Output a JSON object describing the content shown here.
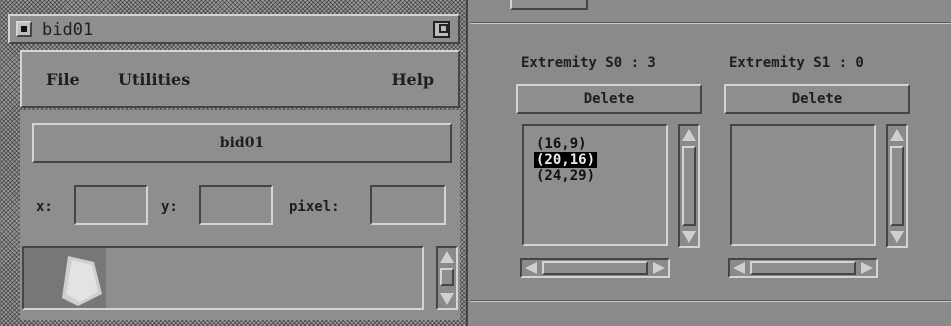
{
  "window": {
    "title": "bid01",
    "menu": {
      "file": "File",
      "utilities": "Utilities",
      "help": "Help"
    },
    "image_name_button": "bid01",
    "coords": {
      "x_label": "x:",
      "y_label": "y:",
      "pixel_label": "pixel:",
      "x_value": "",
      "y_value": "",
      "pixel_value": ""
    }
  },
  "extremities": {
    "s0": {
      "header": "Extremity S0 : 3",
      "delete_label": "Delete",
      "points": [
        "(16,9)",
        "(20,16)",
        "(24,29)"
      ],
      "selected_index": 1
    },
    "s1": {
      "header": "Extremity S1 : 0",
      "delete_label": "Delete",
      "points": []
    }
  },
  "colors": {
    "face": "#8e8e8e",
    "bevel_light": "#d4d4d4",
    "bevel_dark": "#454545",
    "selection_bg": "#000000",
    "selection_fg": "#eeeeee"
  },
  "icons": [
    "window-menu-icon",
    "maximize-icon",
    "scroll-up-arrow-icon",
    "scroll-down-arrow-icon",
    "scroll-left-arrow-icon",
    "scroll-right-arrow-icon"
  ]
}
